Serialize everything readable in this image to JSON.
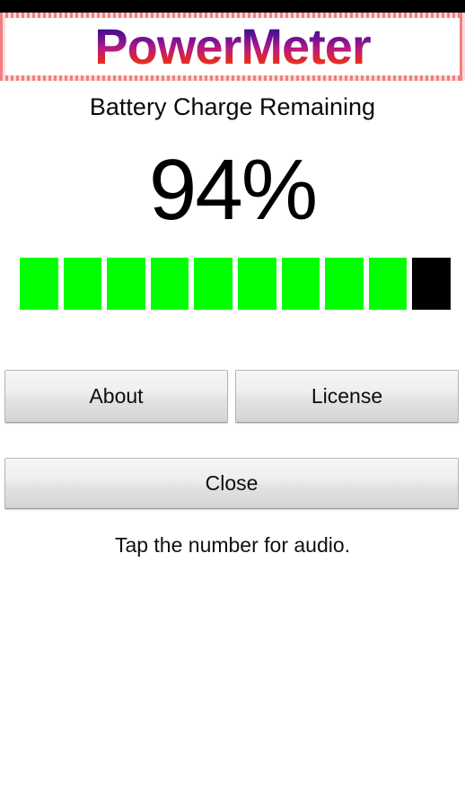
{
  "app": {
    "title": "PowerMeter",
    "title_gradient_top": "#1b0a6e",
    "title_gradient_bottom": "#fa5a12",
    "frame_color": "#f08080"
  },
  "status_bar": {
    "background": "#000000"
  },
  "battery": {
    "label": "Battery Charge Remaining",
    "percent_text": "94%",
    "percent_value": 94,
    "segments_total": 10,
    "segments_filled": 9,
    "segment_on_color": "#00ff00",
    "segment_off_color": "#000000",
    "segments": [
      "on",
      "on",
      "on",
      "on",
      "on",
      "on",
      "on",
      "on",
      "on",
      "off"
    ]
  },
  "buttons": {
    "about_label": "About",
    "license_label": "License",
    "close_label": "Close"
  },
  "hint": {
    "text": "Tap the number for audio."
  }
}
